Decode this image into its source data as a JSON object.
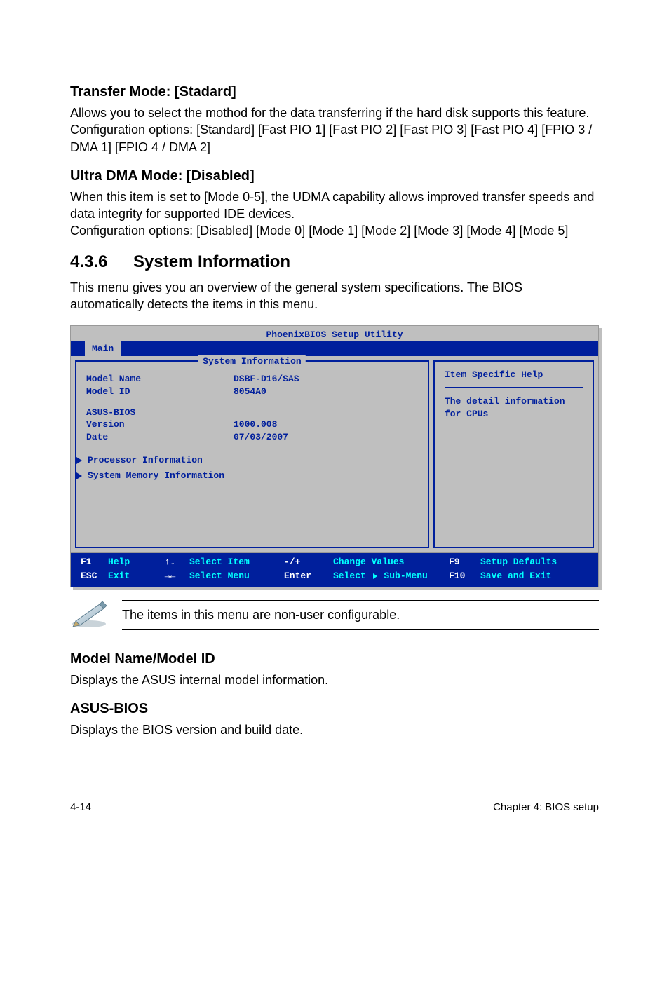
{
  "section1": {
    "heading": "Transfer Mode: [Stadard]",
    "para": "Allows you to select the mothod for the data transferring if the hard disk supports this feature.\nConfiguration options: [Standard] [Fast PIO 1] [Fast PIO 2] [Fast PIO 3] [Fast PIO 4] [FPIO 3 / DMA 1] [FPIO 4 / DMA 2]"
  },
  "section2": {
    "heading": "Ultra DMA Mode: [Disabled]",
    "para": "When this item is set to [Mode 0-5], the UDMA capability allows improved transfer speeds and data integrity for supported IDE devices.\nConfiguration options: [Disabled] [Mode 0] [Mode 1] [Mode 2] [Mode 3] [Mode 4] [Mode 5]"
  },
  "section3": {
    "num": "4.3.6",
    "title": "System Information",
    "para": "This menu gives you an overview of the general system specifications. The BIOS automatically detects the items in this menu."
  },
  "bios": {
    "titlebar": "PhoenixBIOS Setup Utility",
    "tab": "Main",
    "main_header": "System Information",
    "help_header": "Item Specific Help",
    "help_text": "The detail information for CPUs",
    "rows": {
      "model_name_k": "Model Name",
      "model_name_v": "DSBF-D16/SAS",
      "model_id_k": "Model ID",
      "model_id_v": "8054A0",
      "asus_bios_k": "ASUS-BIOS",
      "version_k": "Version",
      "version_v": "1000.008",
      "date_k": "Date",
      "date_v": "07/03/2007"
    },
    "sub1": "Processor Information",
    "sub2": "System Memory Information",
    "footer": {
      "f1": "F1",
      "esc": "ESC",
      "help": "Help",
      "exit": "Exit",
      "arrows_ud": "↑↓",
      "arrows_lr": "→←",
      "select_item": "Select Item",
      "select_menu": "Select Menu",
      "minus_plus": "-/+",
      "enter": "Enter",
      "change_values": "Change Values",
      "select_sub": "Select   Sub-Menu",
      "f9": "F9",
      "f10": "F10",
      "setup_defaults": "Setup Defaults",
      "save_exit": "Save and Exit"
    }
  },
  "note": {
    "text": "The items in this menu are non-user configurable."
  },
  "section4": {
    "heading": "Model Name/Model ID",
    "para": "Displays the ASUS internal model information."
  },
  "section5": {
    "heading": "ASUS-BIOS",
    "para": "Displays the BIOS version and build date."
  },
  "footer": {
    "left": "4-14",
    "right": "Chapter 4: BIOS setup"
  }
}
